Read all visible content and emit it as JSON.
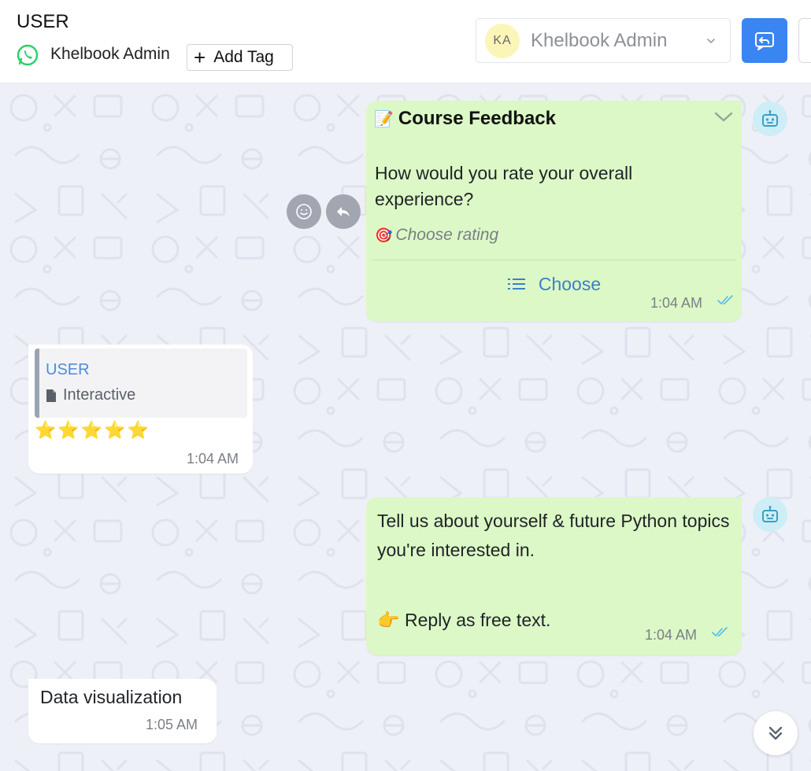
{
  "header": {
    "contact_name": "USER",
    "channel_name": "Khelbook Admin",
    "add_tag_label": "Add Tag",
    "agent": {
      "initials": "KA",
      "name": "Khelbook Admin"
    }
  },
  "messages": [
    {
      "direction": "outgoing",
      "title": "Course Feedback",
      "title_emoji": "📝",
      "body": "How would you rate your overall experience?",
      "footer_emoji": "🎯",
      "footer": "Choose rating",
      "button_label": "Choose",
      "time": "1:04 AM",
      "status": "read"
    },
    {
      "direction": "incoming",
      "quote_author": "USER",
      "quote_text": "Interactive",
      "text": "⭐⭐⭐⭐⭐",
      "time": "1:04 AM"
    },
    {
      "direction": "outgoing",
      "text": "Tell us about yourself & future Python topics you're interested in.",
      "reply_line": "👉 Reply as free text.",
      "time": "1:04 AM",
      "status": "read"
    },
    {
      "direction": "incoming",
      "text": "Data visualization",
      "time": "1:05 AM"
    }
  ],
  "colors": {
    "outgoing_bubble": "#dcf8c6",
    "incoming_bubble": "#ffffff",
    "accent": "#3a85f2",
    "whatsapp_green": "#25d366",
    "chat_background": "#eef0f7"
  },
  "icons": [
    "whatsapp-icon",
    "plus-icon",
    "chevron-down-icon",
    "reply-icon",
    "caret-down-icon",
    "bot-icon",
    "emoji-icon",
    "reply-arrow-icon",
    "list-icon",
    "double-check-icon",
    "document-icon",
    "double-chevron-down-icon"
  ]
}
